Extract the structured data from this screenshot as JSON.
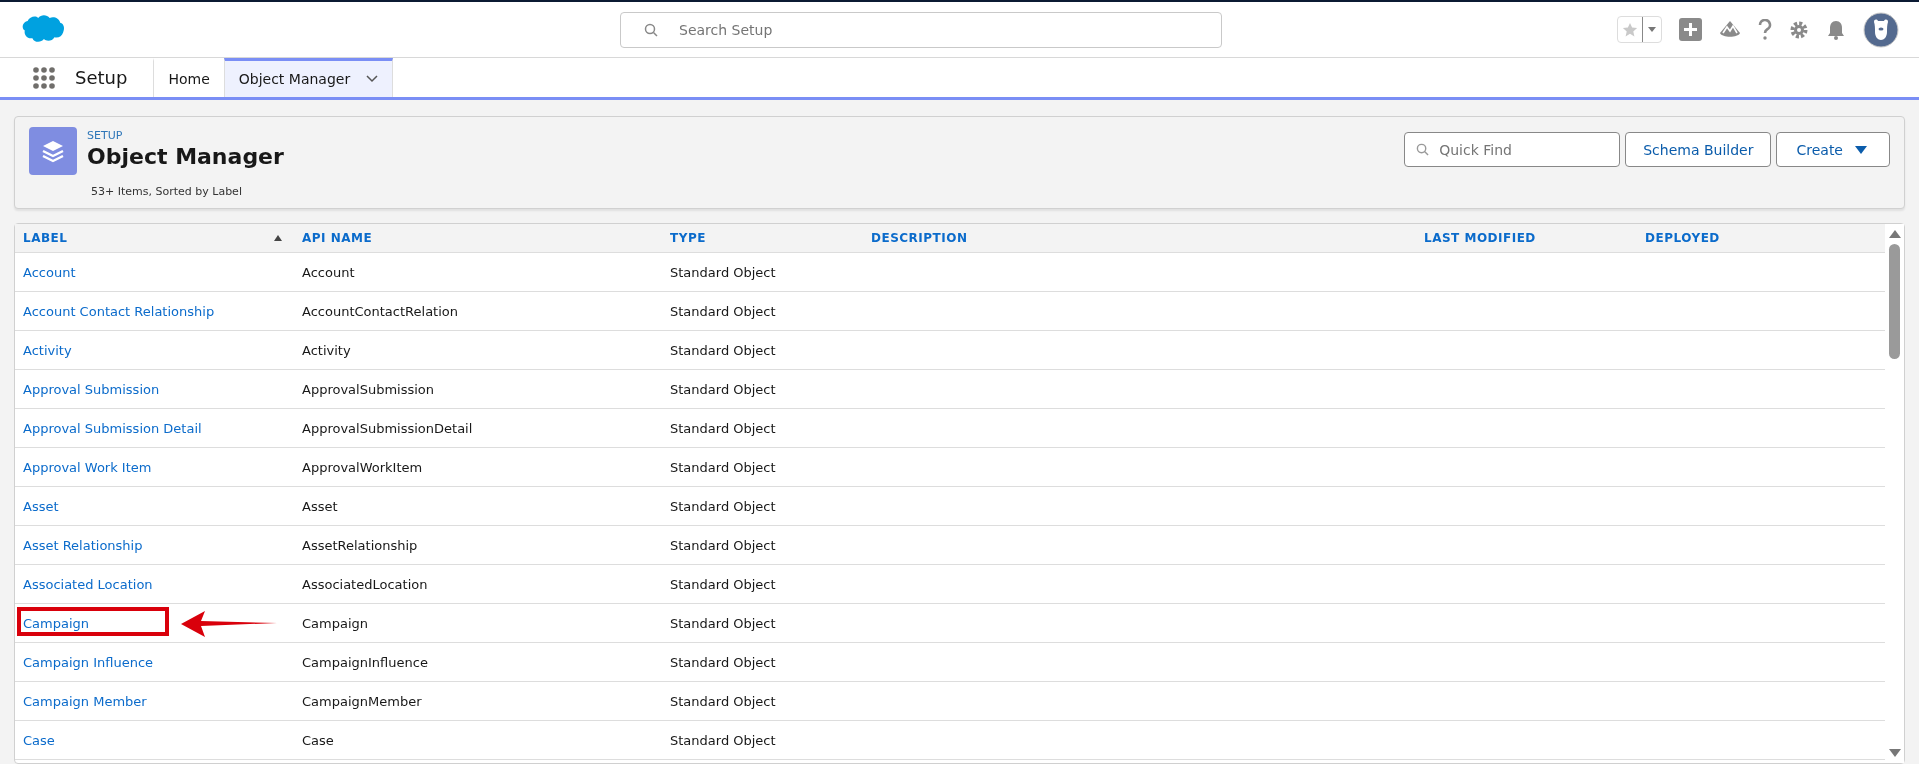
{
  "global_header": {
    "search": {
      "placeholder": "Search Setup"
    }
  },
  "nav": {
    "app_name": "Setup",
    "tabs": [
      {
        "label": "Home",
        "selected": false,
        "has_menu": false
      },
      {
        "label": "Object Manager",
        "selected": true,
        "has_menu": true
      }
    ]
  },
  "page_header": {
    "eyebrow": "SETUP",
    "title": "Object Manager",
    "subtitle": "53+ Items, Sorted by Label",
    "quick_find": {
      "placeholder": "Quick Find"
    },
    "buttons": [
      {
        "label": "Schema Builder",
        "has_menu": false
      },
      {
        "label": "Create",
        "has_menu": true
      }
    ]
  },
  "table": {
    "columns": [
      {
        "label": "LABEL",
        "sorted": true
      },
      {
        "label": "API NAME",
        "sorted": false
      },
      {
        "label": "TYPE",
        "sorted": false
      },
      {
        "label": "DESCRIPTION",
        "sorted": false
      },
      {
        "label": "LAST MODIFIED",
        "sorted": false
      },
      {
        "label": "DEPLOYED",
        "sorted": false
      }
    ],
    "rows": [
      {
        "label": "Account",
        "api_name": "Account",
        "type": "Standard Object",
        "highlighted": false
      },
      {
        "label": "Account Contact Relationship",
        "api_name": "AccountContactRelation",
        "type": "Standard Object",
        "highlighted": false
      },
      {
        "label": "Activity",
        "api_name": "Activity",
        "type": "Standard Object",
        "highlighted": false
      },
      {
        "label": "Approval Submission",
        "api_name": "ApprovalSubmission",
        "type": "Standard Object",
        "highlighted": false
      },
      {
        "label": "Approval Submission Detail",
        "api_name": "ApprovalSubmissionDetail",
        "type": "Standard Object",
        "highlighted": false
      },
      {
        "label": "Approval Work Item",
        "api_name": "ApprovalWorkItem",
        "type": "Standard Object",
        "highlighted": false
      },
      {
        "label": "Asset",
        "api_name": "Asset",
        "type": "Standard Object",
        "highlighted": false
      },
      {
        "label": "Asset Relationship",
        "api_name": "AssetRelationship",
        "type": "Standard Object",
        "highlighted": false
      },
      {
        "label": "Associated Location",
        "api_name": "AssociatedLocation",
        "type": "Standard Object",
        "highlighted": false
      },
      {
        "label": "Campaign",
        "api_name": "Campaign",
        "type": "Standard Object",
        "highlighted": true
      },
      {
        "label": "Campaign Influence",
        "api_name": "CampaignInfluence",
        "type": "Standard Object",
        "highlighted": false
      },
      {
        "label": "Campaign Member",
        "api_name": "CampaignMember",
        "type": "Standard Object",
        "highlighted": false
      },
      {
        "label": "Case",
        "api_name": "Case",
        "type": "Standard Object",
        "highlighted": false
      }
    ]
  }
}
